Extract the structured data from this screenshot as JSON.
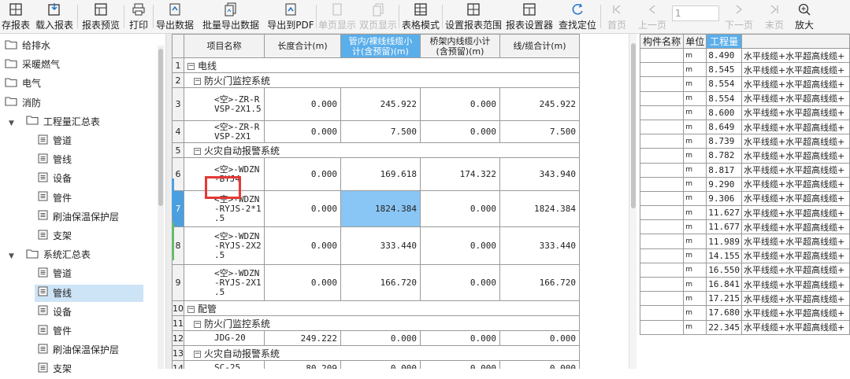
{
  "toolbar": {
    "buttons": [
      {
        "label": "存报表",
        "icon": "grid-icon",
        "disabled": false
      },
      {
        "label": "载入报表",
        "icon": "load-icon",
        "disabled": false
      },
      {
        "label": "报表预览",
        "icon": "preview-icon",
        "disabled": false
      },
      {
        "label": "打印",
        "icon": "print-icon",
        "disabled": false
      },
      {
        "label": "导出数据",
        "icon": "export-icon",
        "disabled": false
      },
      {
        "label": "批量导出数据",
        "icon": "batch-export-icon",
        "disabled": false
      },
      {
        "label": "导出到PDF",
        "icon": "pdf-icon",
        "disabled": false
      },
      {
        "label": "单页显示",
        "icon": "single-page-icon",
        "disabled": true
      },
      {
        "label": "双页显示",
        "icon": "double-page-icon",
        "disabled": true
      },
      {
        "label": "表格模式",
        "icon": "table-mode-icon",
        "disabled": false
      },
      {
        "label": "设置报表范围",
        "icon": "range-icon",
        "disabled": false
      },
      {
        "label": "报表设置器",
        "icon": "settings-icon",
        "disabled": false
      },
      {
        "label": "查找定位",
        "icon": "locate-icon",
        "disabled": false
      },
      {
        "label": "首页",
        "icon": "first-page-icon",
        "disabled": true
      },
      {
        "label": "上一页",
        "icon": "prev-page-icon",
        "disabled": true
      },
      {
        "label": "下一页",
        "icon": "next-page-icon",
        "disabled": true
      },
      {
        "label": "末页",
        "icon": "last-page-icon",
        "disabled": true
      },
      {
        "label": "放大",
        "icon": "zoom-in-icon",
        "disabled": false
      }
    ],
    "page_value": "1"
  },
  "tree": {
    "items": [
      {
        "label": "给排水",
        "type": "folder",
        "level": 0
      },
      {
        "label": "采暖燃气",
        "type": "folder",
        "level": 0
      },
      {
        "label": "电气",
        "type": "folder",
        "level": 0
      },
      {
        "label": "消防",
        "type": "folder",
        "level": 0
      },
      {
        "label": "工程量汇总表",
        "type": "folder",
        "level": 1,
        "expanded": true
      },
      {
        "label": "管道",
        "type": "doc",
        "level": 2
      },
      {
        "label": "管线",
        "type": "doc",
        "level": 2
      },
      {
        "label": "设备",
        "type": "doc",
        "level": 2
      },
      {
        "label": "管件",
        "type": "doc",
        "level": 2
      },
      {
        "label": "刷油保温保护层",
        "type": "doc",
        "level": 2
      },
      {
        "label": "支架",
        "type": "doc",
        "level": 2
      },
      {
        "label": "系统汇总表",
        "type": "folder",
        "level": 1,
        "expanded": true
      },
      {
        "label": "管道",
        "type": "doc",
        "level": 2
      },
      {
        "label": "管线",
        "type": "doc",
        "level": 2,
        "selected": true
      },
      {
        "label": "设备",
        "type": "doc",
        "level": 2
      },
      {
        "label": "管件",
        "type": "doc",
        "level": 2
      },
      {
        "label": "刷油保温保护层",
        "type": "doc",
        "level": 2
      },
      {
        "label": "支架",
        "type": "doc",
        "level": 2
      }
    ]
  },
  "grid": {
    "headers": [
      "项目名称",
      "长度合计(m)",
      "管内/裸线线缆小\n计(含预留)(m)",
      "桥架内线缆小计\n(含预留)(m)",
      "线/缆合计(m)"
    ],
    "highlight_header": 2,
    "rows": [
      {
        "n": "1",
        "group": "电线",
        "indent": 0
      },
      {
        "n": "2",
        "group": "防火门监控系统",
        "indent": 1
      },
      {
        "n": "3",
        "name": "<空>-ZR-R\nVSP-2X1.5",
        "values": [
          "0.000",
          "245.922",
          "0.000",
          "245.922"
        ]
      },
      {
        "n": "4",
        "name": "<空>-ZR-R\nVSP-2X1",
        "values": [
          "0.000",
          "7.500",
          "0.000",
          "7.500"
        ]
      },
      {
        "n": "5",
        "group": "火灾自动报警系统",
        "indent": 1
      },
      {
        "n": "6",
        "name": "<空>-WDZN\n-BYJ4",
        "values": [
          "0.000",
          "169.618",
          "174.322",
          "343.940"
        ]
      },
      {
        "n": "7",
        "name": "<空>-WDZN\n-RYJS-2*1\n.5",
        "values": [
          "0.000",
          "1824.384",
          "0.000",
          "1824.384"
        ],
        "active": true,
        "selected_col": 1
      },
      {
        "n": "8",
        "name": "<空>-WDZN\n-RYJS-2X2\n.5",
        "values": [
          "0.000",
          "333.440",
          "0.000",
          "333.440"
        ]
      },
      {
        "n": "9",
        "name": "<空>-WDZN\n-RYJS-2X1\n.5",
        "values": [
          "0.000",
          "166.720",
          "0.000",
          "166.720"
        ]
      },
      {
        "n": "10",
        "group": "配管",
        "indent": 0
      },
      {
        "n": "11",
        "group": "防火门监控系统",
        "indent": 1
      },
      {
        "n": "12",
        "name": "JDG-20",
        "values": [
          "249.222",
          "0.000",
          "0.000",
          "0.000"
        ]
      },
      {
        "n": "13",
        "group": "火灾自动报警系统",
        "indent": 1
      },
      {
        "n": "14",
        "name": "SC-25",
        "values": [
          "80.209",
          "0.000",
          "0.000",
          "0.000"
        ]
      }
    ]
  },
  "right_panel": {
    "headers": [
      "构件名称",
      "单位",
      "工程量",
      ""
    ],
    "unit": "m",
    "desc": "水平线缆+水平超高线缆+",
    "values": [
      "8.490",
      "8.545",
      "8.554",
      "8.554",
      "8.600",
      "8.649",
      "8.739",
      "8.782",
      "8.817",
      "9.290",
      "9.306",
      "11.627",
      "11.677",
      "11.989",
      "14.155",
      "16.550",
      "16.841",
      "17.215",
      "17.680",
      "22.345"
    ]
  },
  "colors": {
    "accent": "#5aaeea",
    "selected_cell": "#8ac6f5",
    "highlight_box": "#e53935"
  }
}
